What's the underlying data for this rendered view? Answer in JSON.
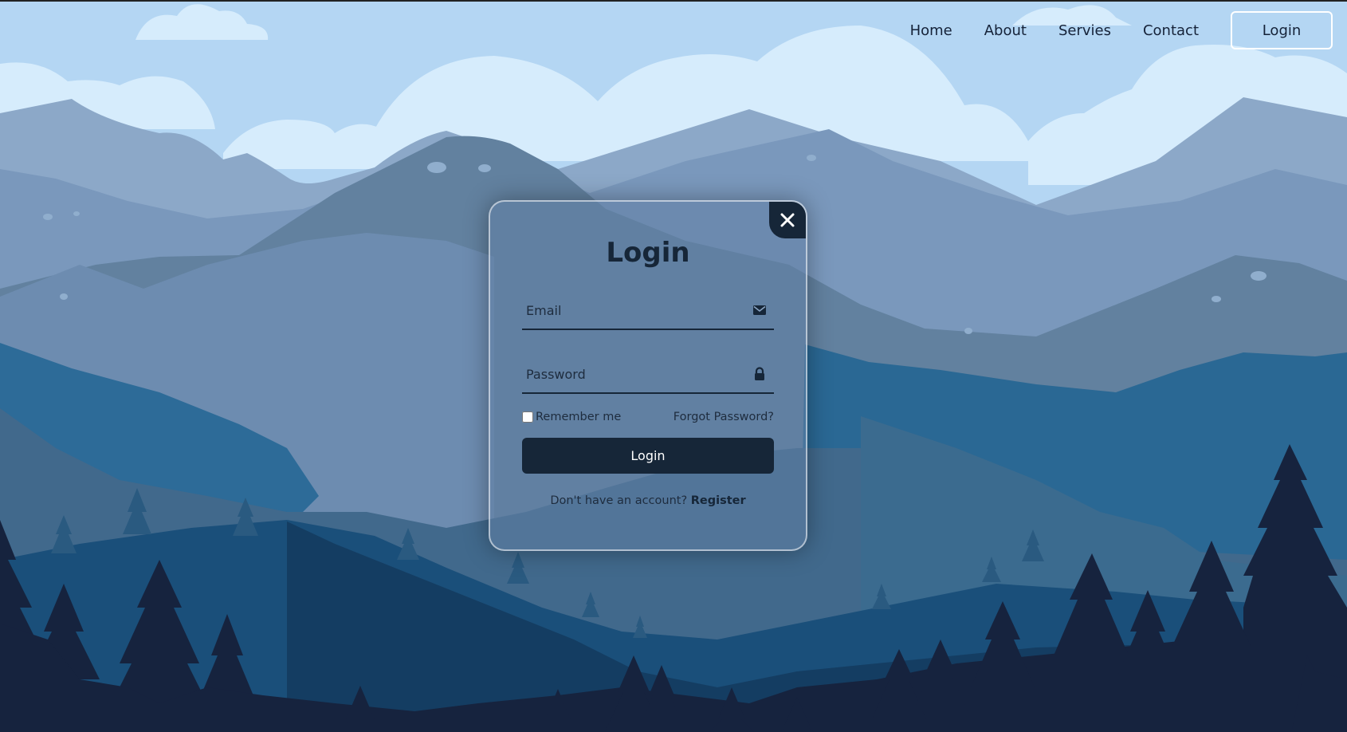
{
  "nav": {
    "links": [
      "Home",
      "About",
      "Servies",
      "Contact"
    ],
    "login_label": "Login"
  },
  "modal": {
    "title": "Login",
    "close_icon": "close-icon",
    "email": {
      "placeholder": "Email",
      "value": "",
      "icon": "mail-icon"
    },
    "password": {
      "placeholder": "Password",
      "value": "",
      "icon": "lock-icon"
    },
    "remember_label": "Remember me",
    "remember_checked": false,
    "forgot_label": "Forgot Password?",
    "submit_label": "Login",
    "register_prompt": "Don't have an account?",
    "register_label": "Register"
  },
  "colors": {
    "sky": "#b4d6f3",
    "cloud": "#d6ecfc",
    "dark_navy": "#162638",
    "mountain_far": "#8ca8c8",
    "mountain_mid": "#6888ae",
    "mountain_teal": "#2e6d9a",
    "forest": "#16233e"
  }
}
